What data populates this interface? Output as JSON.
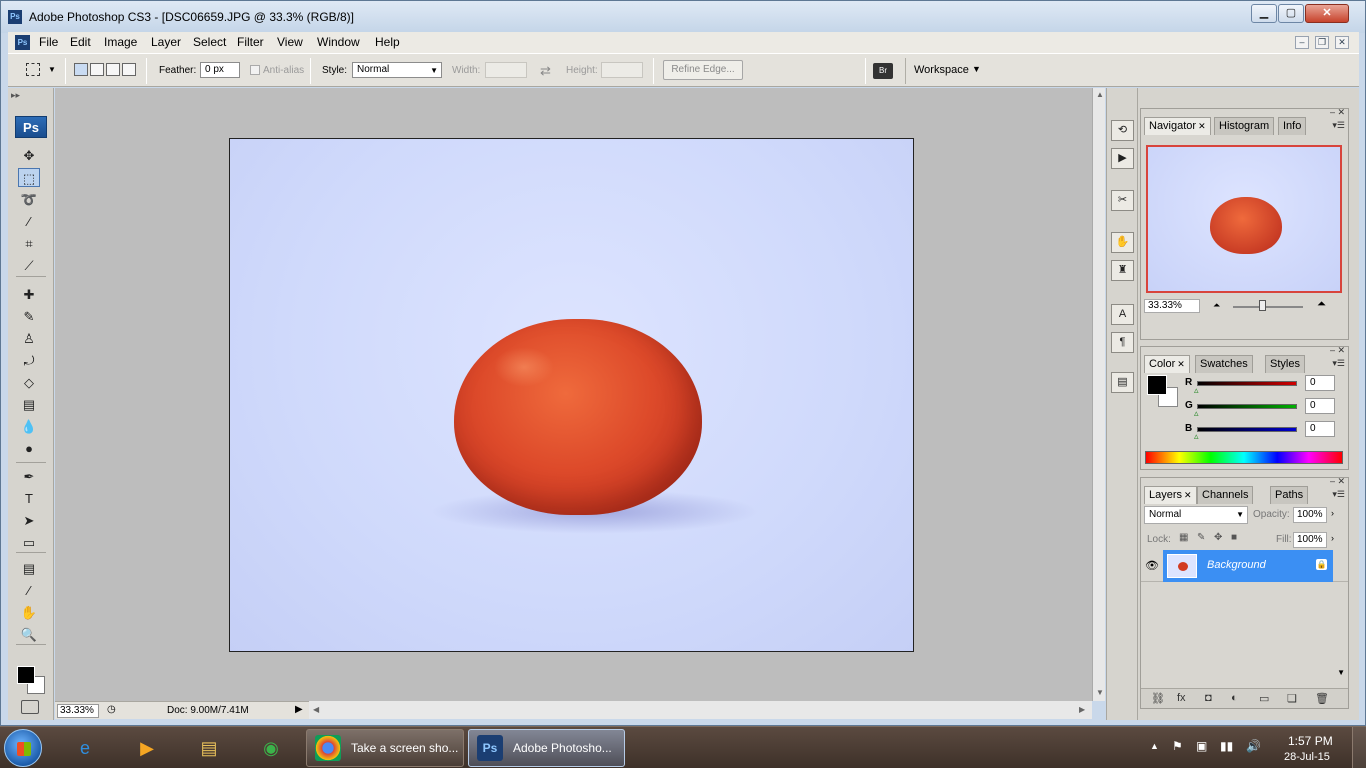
{
  "window": {
    "title": "Adobe Photoshop CS3 - [DSC06659.JPG @ 33.3% (RGB/8)]",
    "app_icon": "Ps",
    "min_glyph": "▁",
    "max_glyph": "▢",
    "close_glyph": "✕"
  },
  "menu": {
    "items": [
      "File",
      "Edit",
      "Image",
      "Layer",
      "Select",
      "Filter",
      "View",
      "Window",
      "Help"
    ],
    "doc_min": "–",
    "doc_restore": "❐",
    "doc_close": "✕"
  },
  "options": {
    "feather_label": "Feather:",
    "feather_value": "0 px",
    "antialias_label": "Anti-alias",
    "style_label": "Style:",
    "style_value": "Normal",
    "width_label": "Width:",
    "height_label": "Height:",
    "refine_edge": "Refine Edge...",
    "workspace": "Workspace",
    "swap_glyph": "⇄",
    "dropdown_glyph": "▼"
  },
  "toolbox": {
    "logo": "Ps",
    "collapse": "▸▸",
    "tools": [
      {
        "icon": "move-tool-icon",
        "glyph": "✥"
      },
      {
        "icon": "marquee-tool-icon",
        "glyph": "⬚"
      },
      {
        "icon": "lasso-tool-icon",
        "glyph": "➰"
      },
      {
        "icon": "magic-wand-icon",
        "glyph": "⁄"
      },
      {
        "icon": "crop-tool-icon",
        "glyph": "⌗"
      },
      {
        "icon": "slice-tool-icon",
        "glyph": "⟋"
      },
      {
        "icon": "healing-brush-icon",
        "glyph": "✚"
      },
      {
        "icon": "brush-tool-icon",
        "glyph": "✎"
      },
      {
        "icon": "clone-stamp-icon",
        "glyph": "♙"
      },
      {
        "icon": "history-brush-icon",
        "glyph": "⤾"
      },
      {
        "icon": "eraser-tool-icon",
        "glyph": "◇"
      },
      {
        "icon": "gradient-tool-icon",
        "glyph": "▤"
      },
      {
        "icon": "blur-tool-icon",
        "glyph": "💧"
      },
      {
        "icon": "dodge-tool-icon",
        "glyph": "●"
      },
      {
        "icon": "pen-tool-icon",
        "glyph": "✒"
      },
      {
        "icon": "type-tool-icon",
        "glyph": "T"
      },
      {
        "icon": "path-selection-icon",
        "glyph": "➤"
      },
      {
        "icon": "shape-tool-icon",
        "glyph": "▭"
      },
      {
        "icon": "notes-tool-icon",
        "glyph": "▤"
      },
      {
        "icon": "eyedropper-tool-icon",
        "glyph": "⁄"
      },
      {
        "icon": "hand-tool-icon",
        "glyph": "✋"
      },
      {
        "icon": "zoom-tool-icon",
        "glyph": "🔍"
      }
    ]
  },
  "status": {
    "zoom": "33.33%",
    "doc": "Doc: 9.00M/7.41M",
    "arrow": "▶"
  },
  "navigator": {
    "tabs": [
      "Navigator",
      "Histogram",
      "Info"
    ],
    "zoom": "33.33%"
  },
  "color": {
    "tabs": [
      "Color",
      "Swatches",
      "Styles"
    ],
    "channels": [
      {
        "label": "R",
        "value": "0",
        "color": "#d10000"
      },
      {
        "label": "G",
        "value": "0",
        "color": "#00b000"
      },
      {
        "label": "B",
        "value": "0",
        "color": "#0000d0"
      }
    ]
  },
  "layers": {
    "tabs": [
      "Layers",
      "Channels",
      "Paths"
    ],
    "blend_mode": "Normal",
    "opacity_label": "Opacity:",
    "opacity": "100%",
    "lock_label": "Lock:",
    "fill_label": "Fill:",
    "fill": "100%",
    "layer_name": "Background",
    "eye_glyph": "👁",
    "lock_glyph": "🔒",
    "footer_icons": [
      "link-icon",
      "fx-icon",
      "mask-icon",
      "adjustment-icon",
      "group-icon",
      "new-layer-icon",
      "trash-icon"
    ],
    "footer_glyphs": [
      "⛓",
      "fx",
      "◘",
      "◐",
      "▭",
      "❏",
      "🗑"
    ]
  },
  "dock": {
    "icons": [
      "history-icon",
      "actions-icon",
      "tools-presets-icon",
      "brushes-icon",
      "clone-source-icon",
      "character-icon",
      "paragraph-icon",
      "layer-comps-icon"
    ],
    "glyphs": [
      "⟲",
      "▶",
      "✂",
      "✋",
      "♜",
      "A",
      "¶",
      "▤"
    ]
  },
  "taskbar": {
    "pins": [
      {
        "icon": "internet-explorer-icon",
        "glyph": "e",
        "color": "#2f8fe0"
      },
      {
        "icon": "media-player-icon",
        "glyph": "▶",
        "color": "#f5a623"
      },
      {
        "icon": "file-explorer-icon",
        "glyph": "▤",
        "color": "#e8c05a"
      },
      {
        "icon": "network-icon",
        "glyph": "◉",
        "color": "#3bb34a"
      }
    ],
    "tasks": [
      {
        "label": "Take a screen sho...",
        "icon": "chrome-icon",
        "glyph": "◎",
        "active": false
      },
      {
        "label": "Adobe Photosho...",
        "icon": "photoshop-icon",
        "glyph": "Ps",
        "active": true
      }
    ],
    "tray_up": "▲",
    "tray_glyphs": [
      "⚑",
      "▣",
      "▮▮",
      "🔊"
    ],
    "time": "1:57 PM",
    "date": "28-Jul-15"
  }
}
